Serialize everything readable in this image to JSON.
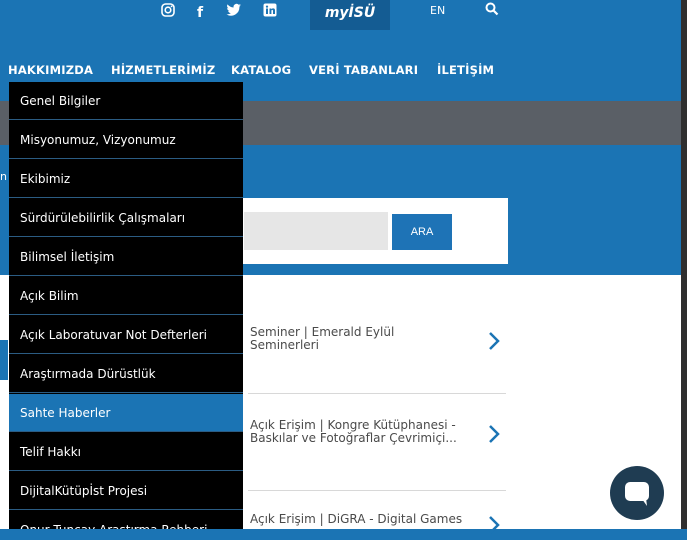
{
  "topbar": {
    "social": [
      "instagram-icon",
      "facebook-icon",
      "twitter-icon",
      "linkedin-icon"
    ],
    "myisu": "myİSÜ",
    "lang": "EN"
  },
  "nav": {
    "items": [
      "HAKKIMIZDA",
      "HİZMETLERİMİZ",
      "KATALOG",
      "VERİ TABANLARI",
      "İLETİŞİM"
    ]
  },
  "dropdown": {
    "items": [
      "Genel Bilgiler",
      "Misyonumuz, Vizyonumuz",
      "Ekibimiz",
      "Sürdürülebilirlik Çalışmaları",
      "Bilimsel İletişim",
      "Açık Bilim",
      "Açık Laboratuvar Not Defterleri",
      "Araştırmada Dürüstlük",
      "Sahte Haberler",
      "Telif Hakkı",
      "DijitalKütüpİst Projesi",
      "Onur Tuncay Araştırma Rehberi"
    ],
    "active_index": 8
  },
  "search": {
    "button": "ARA"
  },
  "crumb": "n",
  "news": [
    {
      "line1": "Seminer | Emerald Eylül",
      "line2": "Seminerleri"
    },
    {
      "line1": "Açık Erişim | Kongre Kütüphanesi -",
      "line2": "Baskılar ve Fotoğraflar Çevrimiçi..."
    },
    {
      "line1": "Açık Erişim | DiGRA - Digital Games",
      "line2": ""
    }
  ],
  "colors": {
    "brand": "#1b74b4",
    "dark": "#000000",
    "chat": "#1f3c52"
  }
}
